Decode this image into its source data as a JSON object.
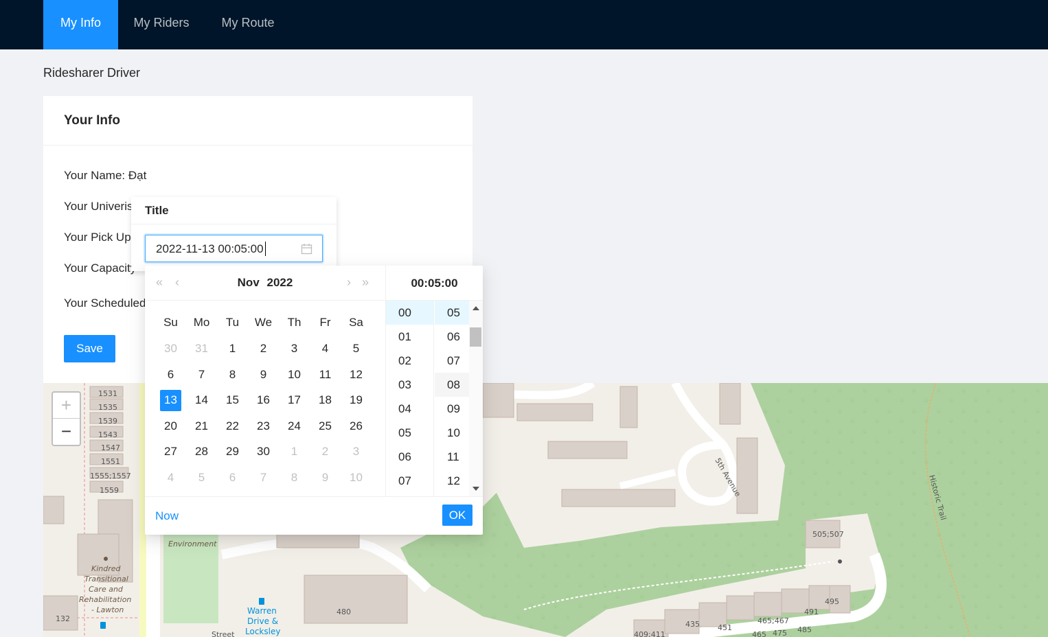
{
  "nav": {
    "items": [
      {
        "label": "My Info",
        "active": true
      },
      {
        "label": "My Riders"
      },
      {
        "label": "My Route"
      }
    ]
  },
  "page_label": "Ridesharer Driver",
  "card": {
    "title": "Your Info",
    "fields": [
      "Your Name: Đạt",
      "Your Univeris",
      "Your Pick Up",
      "Your Capacity",
      "Your Scheduled"
    ],
    "save_label": "Save"
  },
  "modal": {
    "title": "Title",
    "input_value": "2022-11-13 00:05:00"
  },
  "picker": {
    "month": "Nov",
    "year": "2022",
    "weekdays": [
      "Su",
      "Mo",
      "Tu",
      "We",
      "Th",
      "Fr",
      "Sa"
    ],
    "weeks": [
      [
        "30",
        "31",
        "1",
        "2",
        "3",
        "4",
        "5"
      ],
      [
        "6",
        "7",
        "8",
        "9",
        "10",
        "11",
        "12"
      ],
      [
        "13",
        "14",
        "15",
        "16",
        "17",
        "18",
        "19"
      ],
      [
        "20",
        "21",
        "22",
        "23",
        "24",
        "25",
        "26"
      ],
      [
        "27",
        "28",
        "29",
        "30",
        "1",
        "2",
        "3"
      ],
      [
        "4",
        "5",
        "6",
        "7",
        "8",
        "9",
        "10"
      ]
    ],
    "selected_day": "13",
    "time_header": "00:05:00",
    "hours": [
      "00",
      "01",
      "02",
      "03",
      "04",
      "05",
      "06",
      "07"
    ],
    "minutes": [
      "05",
      "06",
      "07",
      "08",
      "09",
      "10",
      "11",
      "12"
    ],
    "now_label": "Now",
    "ok_label": "OK",
    "accent": "#1890ff"
  },
  "map": {
    "labels": {
      "addresses_left": [
        "1531",
        "1535",
        "1539",
        "1543",
        "1547",
        "1551",
        "1555;1557",
        "1559"
      ],
      "kindred": [
        "Kindred",
        "Transitional",
        "Care and",
        "Rehabilitation",
        "- Lawton"
      ],
      "environment": [
        "Environment"
      ],
      "warren": [
        "Warren",
        "Drive &",
        "Locksley"
      ],
      "n132": "132",
      "n480": "480",
      "n435": "435",
      "n451": "451",
      "n465_467": "465;467",
      "n475": "475",
      "n485": "485",
      "n491": "491",
      "n495": "495",
      "n505_507": "505;507",
      "fifth_ave": "5th Avenue",
      "historic_trail": "Historic Trail",
      "street": "Street",
      "n409_411": "409;411",
      "n465": "465"
    },
    "colors": {
      "land": "#f2efe9",
      "park": "#add19e",
      "building": "#d9d0c9",
      "road": "#ffffff"
    }
  }
}
